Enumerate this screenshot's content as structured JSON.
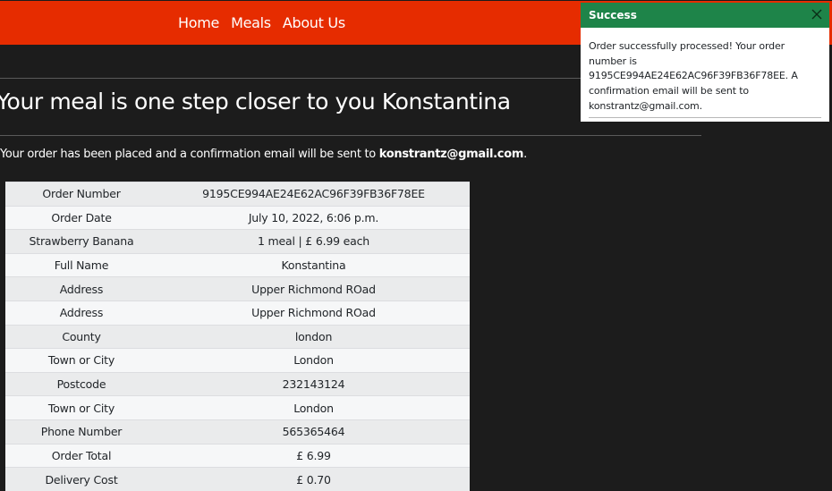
{
  "nav": {
    "items": [
      {
        "label": "Home"
      },
      {
        "label": "Meals"
      },
      {
        "label": "About Us"
      }
    ]
  },
  "page": {
    "title": "Your meal is one step closer to you Konstantina",
    "confirm_prefix": "Your order has been placed and a confirmation email will be sent to ",
    "confirm_email": "konstrantz@gmail.com",
    "confirm_suffix": "."
  },
  "order": {
    "rows": [
      {
        "label": "Order Number",
        "value": "9195CE994AE24E62AC96F39FB36F78EE"
      },
      {
        "label": "Order Date",
        "value": "July 10, 2022, 6:06 p.m."
      },
      {
        "label": "Strawberry Banana",
        "value": "1 meal | £ 6.99 each"
      },
      {
        "label": "Full Name",
        "value": "Konstantina"
      },
      {
        "label": "Address",
        "value": "Upper Richmond ROad"
      },
      {
        "label": "Address",
        "value": "Upper Richmond ROad"
      },
      {
        "label": "County",
        "value": "london"
      },
      {
        "label": "Town or City",
        "value": "London"
      },
      {
        "label": "Postcode",
        "value": "232143124"
      },
      {
        "label": "Town or City",
        "value": "London"
      },
      {
        "label": "Phone Number",
        "value": "565365464"
      },
      {
        "label": "Order Total",
        "value": "£ 6.99"
      },
      {
        "label": "Delivery Cost",
        "value": "£ 0.70"
      }
    ]
  },
  "toast": {
    "title": "Success",
    "message": "Order successfully processed! Your order number is 9195CE994AE24E62AC96F39FB36F78EE. A confirmation email will be sent to konstrantz@gmail.com."
  },
  "colors": {
    "navbar": "#e62c00",
    "background": "#1c1c1c",
    "toast_header": "#1e8449"
  }
}
